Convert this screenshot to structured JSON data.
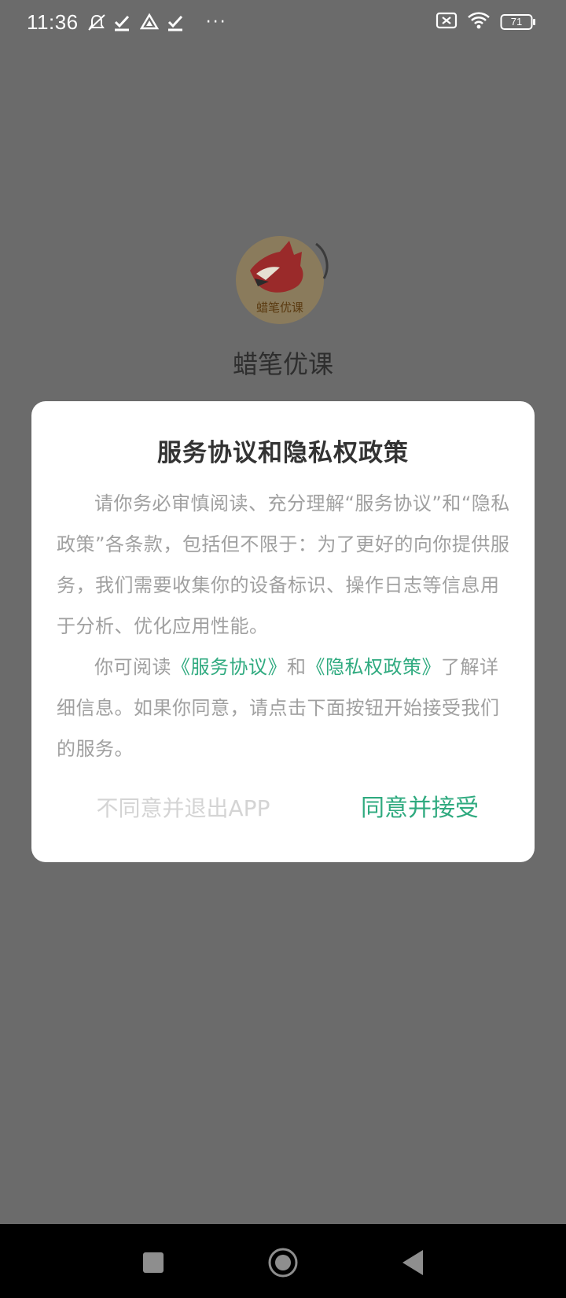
{
  "status_bar": {
    "time": "11:36",
    "icons": [
      "mute-icon",
      "check-icon",
      "drive-icon",
      "check-icon",
      "more-dots-icon"
    ],
    "more": "···",
    "battery": "71",
    "right_icons": [
      "sim-x-icon",
      "wifi-icon",
      "battery-icon"
    ]
  },
  "splash": {
    "logo_text": "蜡笔优课",
    "app_name": "蜡笔优课"
  },
  "dialog": {
    "title": "服务协议和隐私权政策",
    "paragraph1": "请你务必审慎阅读、充分理解“服务协议”和“隐私政策”各条款，包括但不限于：为了更好的向你提供服务，我们需要收集你的设备标识、操作日志等信息用于分析、优化应用性能。",
    "p2_prefix": "你可阅读",
    "link_service": "《服务协议》",
    "p2_and": "和",
    "link_privacy": "《隐私权政策》",
    "p2_suffix": "了解详细信息。如果你同意，请点击下面按钮开始接受我们的服务。",
    "decline_label": "不同意并退出APP",
    "agree_label": "同意并接受"
  },
  "colors": {
    "accent": "#2faa7f",
    "overlay": "#6b6b6b",
    "body_text": "#a0a0a0",
    "disabled_text": "#d4d4d4"
  },
  "nav_bar": {
    "icons": [
      "recents-square-icon",
      "home-circle-icon",
      "back-triangle-icon"
    ]
  }
}
